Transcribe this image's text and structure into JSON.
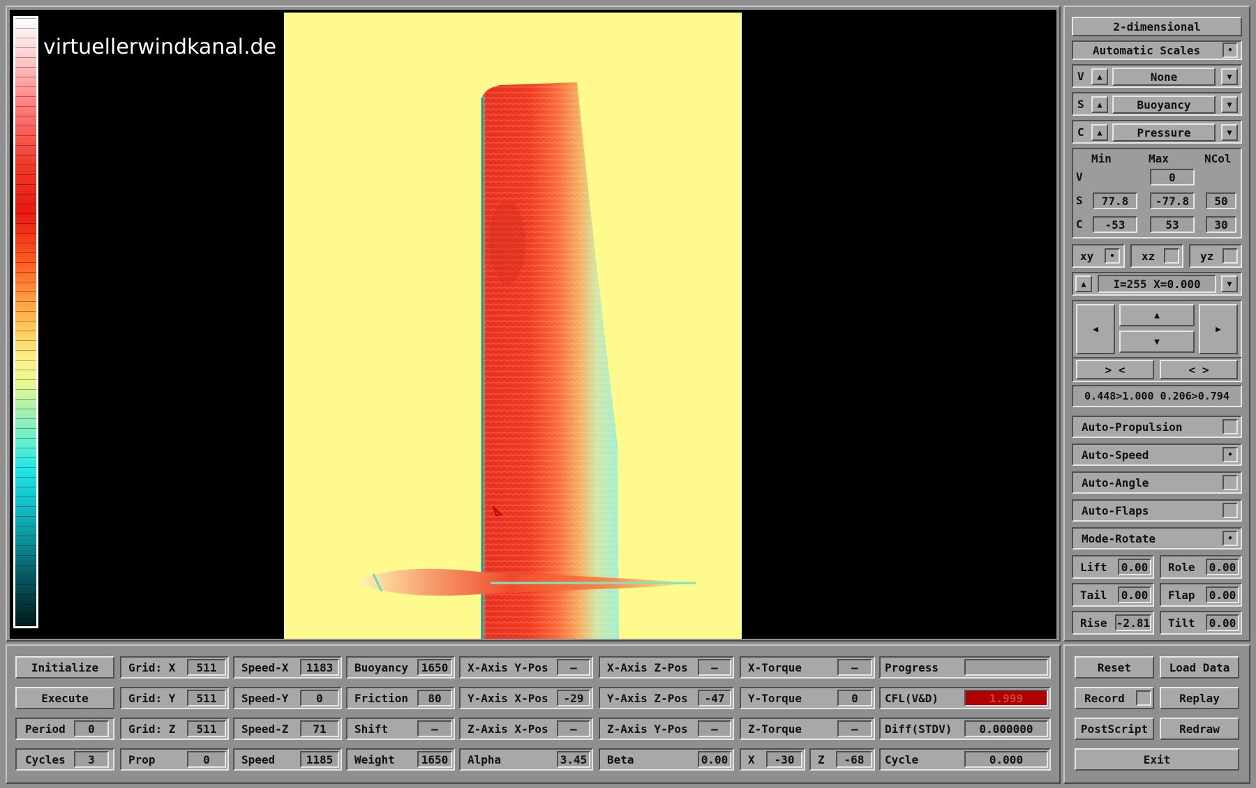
{
  "watermark": "virtuellerwindkanal.de",
  "colors": {
    "sim_background": "#fefa8e",
    "cfl_alert": "#b00000",
    "body_red": "#e8301e",
    "body_cyan": "#7be6c0"
  },
  "right": {
    "mode_button": "2-dimensional",
    "auto_scales": {
      "label": "Automatic Scales",
      "checked": true,
      "mark": "•"
    },
    "var_rows": [
      {
        "letter": "V",
        "value": "None"
      },
      {
        "letter": "S",
        "value": "Buoyancy"
      },
      {
        "letter": "C",
        "value": "Pressure"
      }
    ],
    "scale_headers": {
      "min": "Min",
      "max": "Max",
      "ncol": "NCol"
    },
    "scale_rows": [
      {
        "letter": "V",
        "min": "",
        "max": "0",
        "ncol": ""
      },
      {
        "letter": "S",
        "min": "77.8",
        "max": "-77.8",
        "ncol": "50"
      },
      {
        "letter": "C",
        "min": "-53",
        "max": "53",
        "ncol": "30"
      }
    ],
    "planes": [
      {
        "label": "xy",
        "checked": true,
        "mark": "•"
      },
      {
        "label": "xz",
        "checked": false,
        "mark": ""
      },
      {
        "label": "yz",
        "checked": false,
        "mark": ""
      }
    ],
    "slice": "I=255  X=0.000",
    "zoom_in": "> <",
    "zoom_out": "< >",
    "range": "0.448>1.000 0.206>0.794",
    "toggles": [
      {
        "label": "Auto-Propulsion",
        "checked": false,
        "mark": ""
      },
      {
        "label": "Auto-Speed",
        "checked": true,
        "mark": "•"
      },
      {
        "label": "Auto-Angle",
        "checked": false,
        "mark": ""
      },
      {
        "label": "Auto-Flaps",
        "checked": false,
        "mark": ""
      },
      {
        "label": "Mode-Rotate",
        "checked": true,
        "mark": "•"
      }
    ],
    "params": [
      [
        {
          "label": "Lift",
          "value": "0.00"
        },
        {
          "label": "Role",
          "value": "0.00"
        }
      ],
      [
        {
          "label": "Tail",
          "value": "0.00"
        },
        {
          "label": "Flap",
          "value": "0.00"
        }
      ],
      [
        {
          "label": "Rise",
          "value": "-2.81"
        },
        {
          "label": "Tilt",
          "value": "0.00"
        }
      ]
    ]
  },
  "bottom": {
    "col1": [
      {
        "button": "Initialize"
      },
      {
        "button": "Execute"
      },
      {
        "label": "Period",
        "value": "0"
      },
      {
        "label": "Cycles",
        "value": "3"
      }
    ],
    "col2": [
      {
        "label": "Grid: X",
        "value": "511"
      },
      {
        "label": "Grid: Y",
        "value": "511"
      },
      {
        "label": "Grid: Z",
        "value": "511"
      },
      {
        "label": "Prop",
        "value": "0"
      }
    ],
    "col3": [
      {
        "label": "Speed-X",
        "value": "1183"
      },
      {
        "label": "Speed-Y",
        "value": "0"
      },
      {
        "label": "Speed-Z",
        "value": "71"
      },
      {
        "label": "Speed",
        "value": "1185"
      }
    ],
    "col4": [
      {
        "label": "Buoyancy",
        "value": "1650"
      },
      {
        "label": "Friction",
        "value": "80"
      },
      {
        "label": "Shift",
        "value": "—"
      },
      {
        "label": "Weight",
        "value": "1650"
      }
    ],
    "col5": [
      {
        "label": "X-Axis Y-Pos",
        "value": "—"
      },
      {
        "label": "Y-Axis X-Pos",
        "value": "-29"
      },
      {
        "label": "Z-Axis X-Pos",
        "value": "—"
      },
      {
        "label": "Alpha",
        "value": "3.45"
      }
    ],
    "col6": [
      {
        "label": "X-Axis Z-Pos",
        "value": "—"
      },
      {
        "label": "Y-Axis Z-Pos",
        "value": "-47"
      },
      {
        "label": "Z-Axis Y-Pos",
        "value": "—"
      },
      {
        "label": "Beta",
        "value": "0.00"
      }
    ],
    "col7": [
      {
        "label": "X-Torque",
        "value": "—"
      },
      {
        "label": "Y-Torque",
        "value": "0"
      },
      {
        "label": "Z-Torque",
        "value": "—"
      }
    ],
    "coords": {
      "x_label": "X",
      "x_value": "-30",
      "z_label": "Z",
      "z_value": "-68"
    },
    "col8": [
      {
        "label": "Progress",
        "value": ""
      },
      {
        "label": "CFL(V&D)",
        "value": "1.999"
      },
      {
        "label": "Diff(STDV)",
        "value": "0.000000"
      },
      {
        "label": "Cycle",
        "value": "0.000"
      }
    ],
    "actions": [
      [
        "Reset",
        "Load Data"
      ],
      [
        "Record",
        "Replay"
      ],
      [
        "PostScript",
        "Redraw"
      ]
    ],
    "exit": "Exit"
  }
}
